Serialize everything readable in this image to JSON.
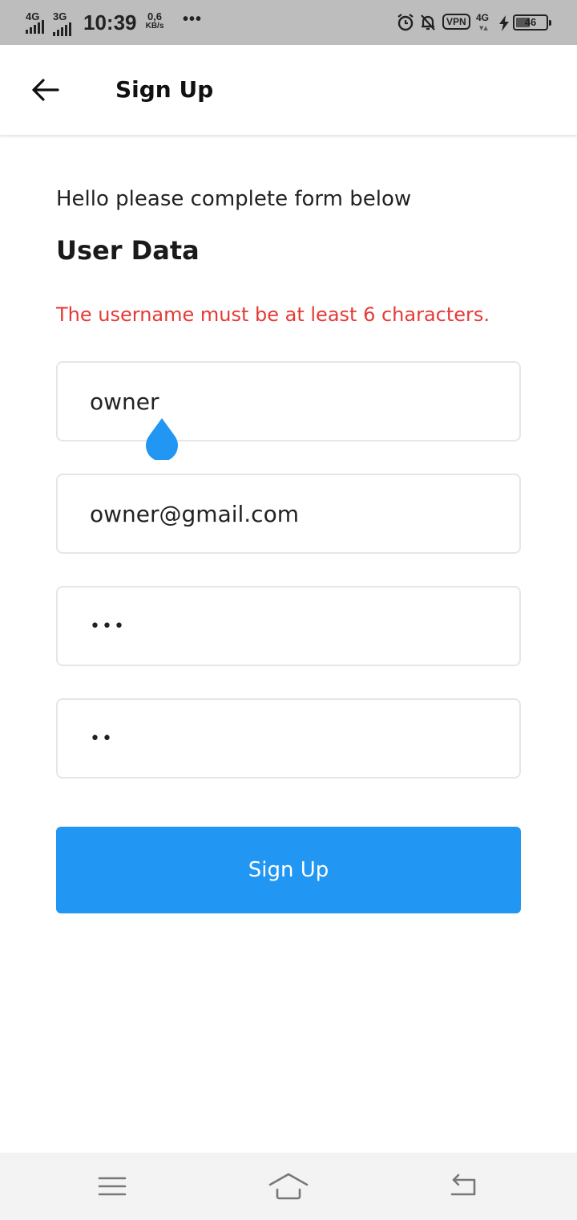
{
  "status_bar": {
    "network_1": "4G",
    "network_2": "3G",
    "time": "10:39",
    "speed_value": "0,6",
    "speed_unit": "KB/s",
    "more": "•••",
    "vpn": "VPN",
    "network_3": "4G",
    "battery_level": "46",
    "battery_percent": 46,
    "icons": [
      "alarm-icon",
      "notifications-off-icon",
      "charging-icon"
    ]
  },
  "app_bar": {
    "back_icon": "arrow-left-icon",
    "title": "Sign Up"
  },
  "form": {
    "intro": "Hello please complete form below",
    "section_title": "User Data",
    "error": "The username must be at least 6 characters.",
    "fields": {
      "username": "owner",
      "email": "owner@gmail.com",
      "password": "•••",
      "confirm_password": "••"
    },
    "submit_label": "Sign Up"
  },
  "colors": {
    "accent": "#2196f3",
    "error": "#e53935",
    "status_bar": "#bdbdbd",
    "nav_bar": "#f3f3f3"
  },
  "nav_bar": {
    "icons": [
      "menu-icon",
      "home-icon",
      "back-icon"
    ]
  }
}
